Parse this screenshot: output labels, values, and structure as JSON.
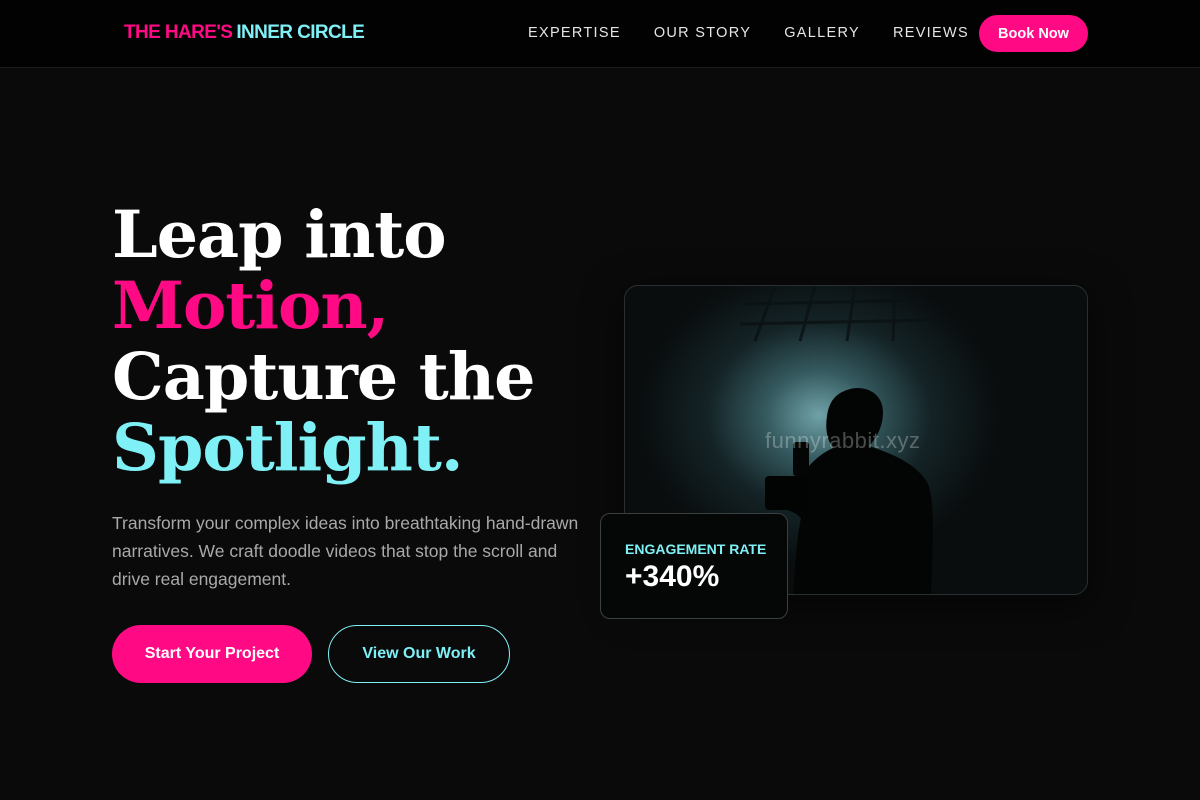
{
  "nav": {
    "brand_part1": "THE HARE'S",
    "brand_part2": "INNER CIRCLE",
    "links": [
      "EXPERTISE",
      "OUR STORY",
      "GALLERY",
      "REVIEWS"
    ],
    "cta": "Book Now"
  },
  "hero": {
    "line1": "Leap into",
    "line2": "Motion,",
    "line3": "Capture the",
    "line4": "Spotlight.",
    "subtitle": "Transform your complex ideas into breathtaking hand-drawn narratives. We craft doodle videos that stop the scroll and drive real engagement.",
    "primary_cta": "Start Your Project",
    "secondary_cta": "View Our Work"
  },
  "image": {
    "watermark": "funnyrabbit.xyz"
  },
  "stat": {
    "label": "ENGAGEMENT RATE",
    "value": "+340%"
  },
  "colors": {
    "accent_pink": "#ff0a84",
    "accent_cyan": "#7ef0f6",
    "background": "#0a0a0a"
  }
}
